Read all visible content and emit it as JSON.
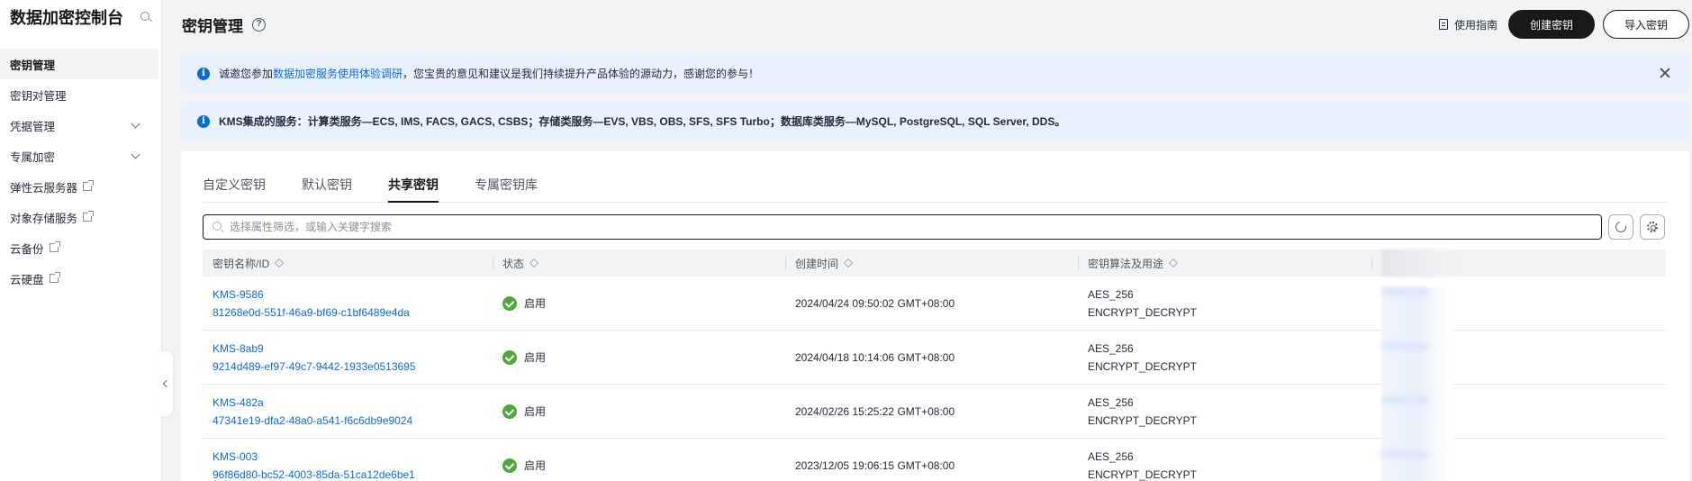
{
  "sidebar": {
    "title": "数据加密控制台",
    "items": [
      {
        "label": "密钥管理",
        "active": true,
        "expandable": false,
        "external": false
      },
      {
        "label": "密钥对管理",
        "active": false,
        "expandable": false,
        "external": false
      },
      {
        "label": "凭据管理",
        "active": false,
        "expandable": true,
        "external": false
      },
      {
        "label": "专属加密",
        "active": false,
        "expandable": true,
        "external": false
      },
      {
        "label": "弹性云服务器",
        "active": false,
        "expandable": false,
        "external": true
      },
      {
        "label": "对象存储服务",
        "active": false,
        "expandable": false,
        "external": true
      },
      {
        "label": "云备份",
        "active": false,
        "expandable": false,
        "external": true
      },
      {
        "label": "云硬盘",
        "active": false,
        "expandable": false,
        "external": true
      }
    ]
  },
  "header": {
    "title": "密钥管理",
    "help_icon": "?",
    "guide_label": "使用指南",
    "create_button": "创建密钥",
    "import_button": "导入密钥"
  },
  "banners": {
    "survey": {
      "prefix": "诚邀您参加",
      "link": "数据加密服务使用体验调研",
      "suffix": "，您宝贵的意见和建议是我们持续提升产品体验的源动力，感谢您的参与！"
    },
    "integration": "KMS集成的服务：计算类服务—ECS, IMS, FACS, GACS, CSBS；存储类服务—EVS, VBS, OBS, SFS, SFS Turbo；数据库类服务—MySQL, PostgreSQL, SQL Server, DDS。",
    "info_icon": "i"
  },
  "tabs": [
    {
      "label": "自定义密钥",
      "active": false
    },
    {
      "label": "默认密钥",
      "active": false
    },
    {
      "label": "共享密钥",
      "active": true
    },
    {
      "label": "专属密钥库",
      "active": false
    }
  ],
  "search": {
    "placeholder": "选择属性筛选，或输入关键字搜索"
  },
  "table": {
    "columns": [
      "密钥名称/ID",
      "状态",
      "创建时间",
      "密钥算法及用途"
    ],
    "rows": [
      {
        "name": "KMS-9586",
        "id": "81268e0d-551f-46a9-bf69-c1bf6489e4da",
        "status": "启用",
        "created": "2024/04/24 09:50:02 GMT+08:00",
        "algorithm": "AES_256",
        "usage": "ENCRYPT_DECRYPT"
      },
      {
        "name": "KMS-8ab9",
        "id": "9214d489-ef97-49c7-9442-1933e0513695",
        "status": "启用",
        "created": "2024/04/18 10:14:06 GMT+08:00",
        "algorithm": "AES_256",
        "usage": "ENCRYPT_DECRYPT"
      },
      {
        "name": "KMS-482a",
        "id": "47341e19-dfa2-48a0-a541-f6c6db9e9024",
        "status": "启用",
        "created": "2024/02/26 15:25:22 GMT+08:00",
        "algorithm": "AES_256",
        "usage": "ENCRYPT_DECRYPT"
      },
      {
        "name": "KMS-003",
        "id": "96f86d80-bc52-4003-85da-51ca12de6be1",
        "status": "启用",
        "created": "2023/12/05 19:06:15 GMT+08:00",
        "algorithm": "AES_256",
        "usage": "ENCRYPT_DECRYPT"
      }
    ]
  },
  "colors": {
    "accent": "#0a6bd6",
    "primary_button": "#191919",
    "banner_bg": "#e8f2fe",
    "status_ok": "#4ca935"
  }
}
